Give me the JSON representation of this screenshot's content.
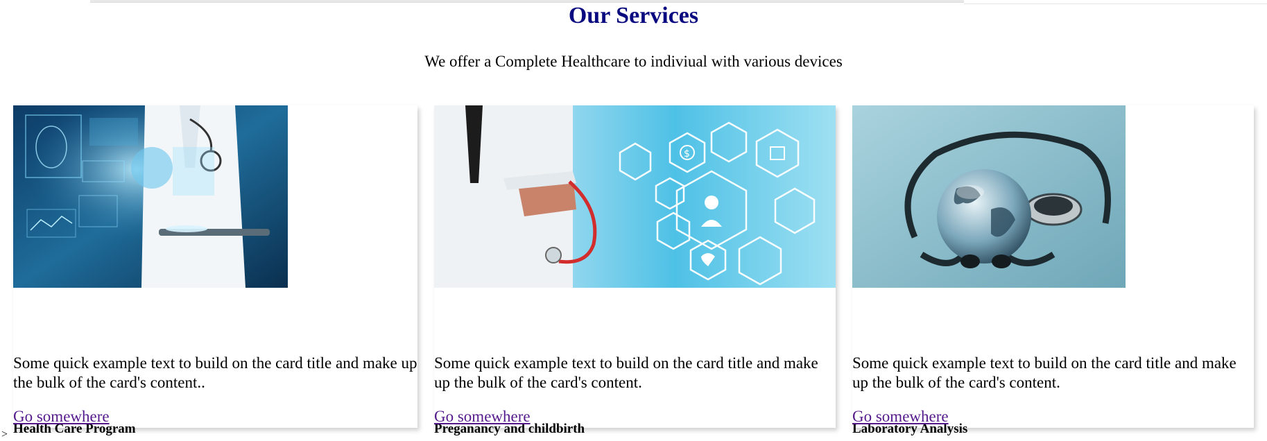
{
  "header": {
    "title": "Our Services",
    "subtitle": "We offer a Complete Healthcare to indiviual with various devices"
  },
  "cards": [
    {
      "image_alt": "doctor-with-tablet-image",
      "title": "Health Care Program",
      "text": "Some quick example text to build on the card title and make up the bulk of the card's content..",
      "link": "Go somewhere"
    },
    {
      "image_alt": "doctor-medical-icons-image",
      "title": "Preganancy and childbirth",
      "text": "Some quick example text to build on the card title and make up the bulk of the card's content.",
      "link": "Go somewhere"
    },
    {
      "image_alt": "globe-stethoscope-image",
      "title": "Laboratory Analysis",
      "text": "Some quick example text to build on the card title and make up the bulk of the card's content.",
      "link": "Go somewhere"
    }
  ],
  "stray_text": ">",
  "colors": {
    "title": "#0a0a80",
    "visited_link": "#551a8b"
  }
}
